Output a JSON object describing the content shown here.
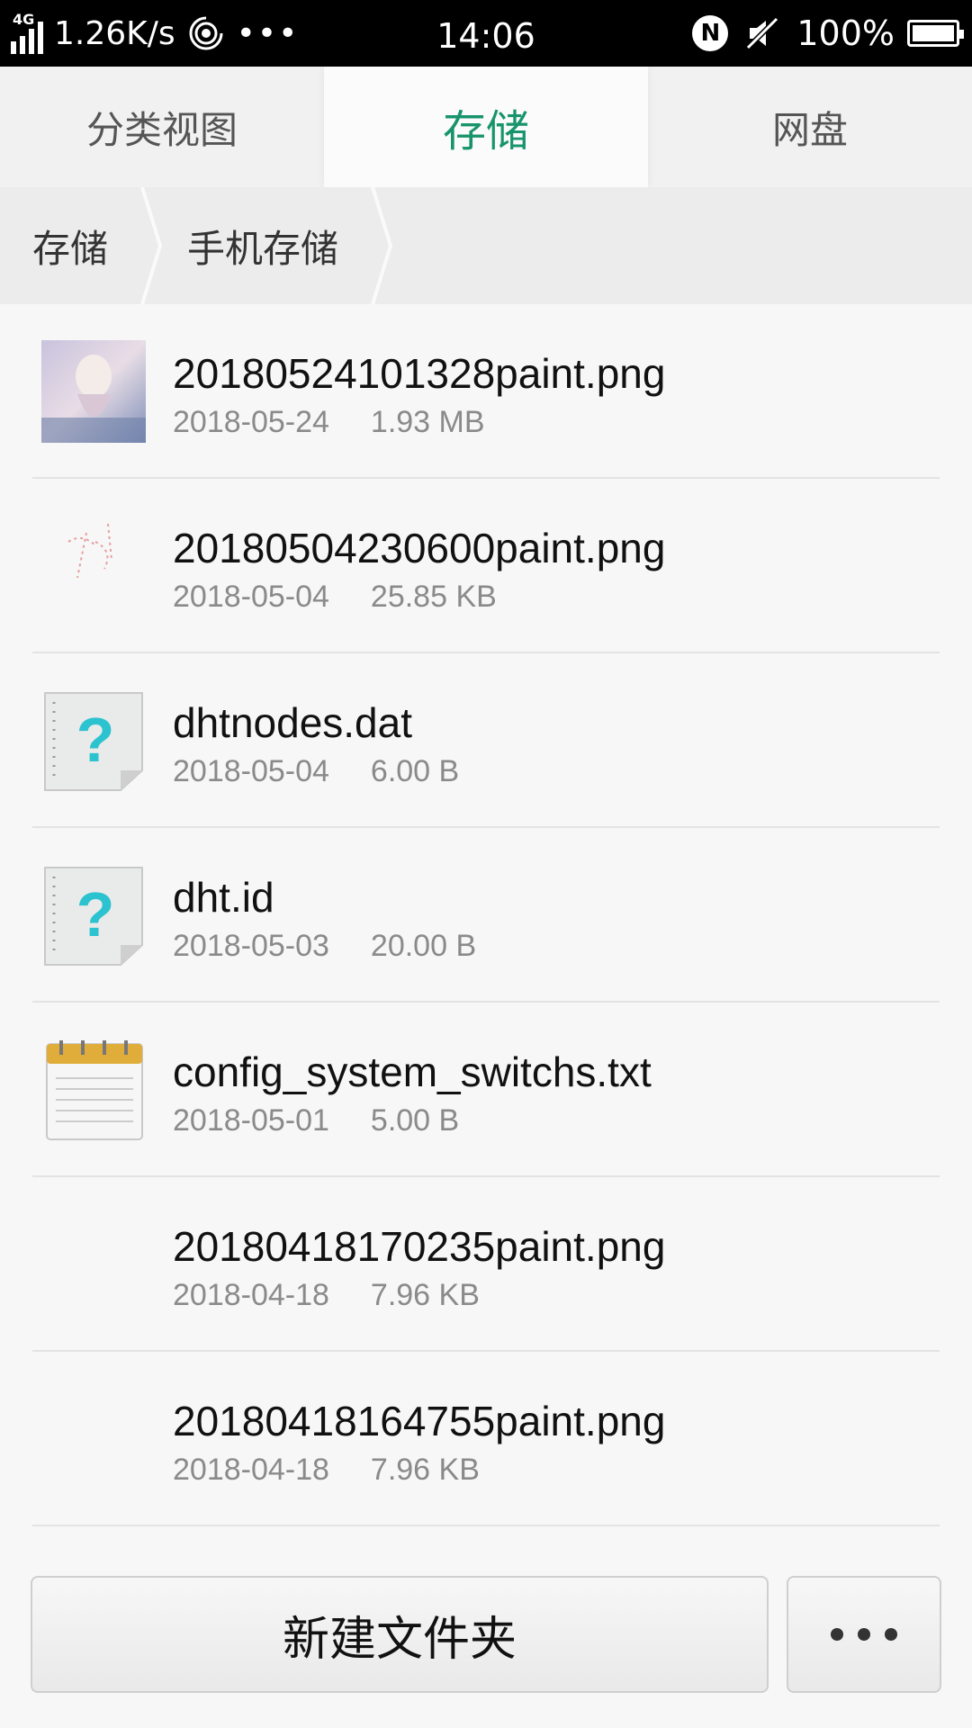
{
  "status_bar": {
    "network_type": "4G",
    "speed": "1.26K/s",
    "more": "•••",
    "time": "14:06",
    "nfc": "N",
    "battery": "100%"
  },
  "tabs": [
    {
      "label": "分类视图"
    },
    {
      "label": "存储"
    },
    {
      "label": "网盘"
    }
  ],
  "breadcrumb": [
    {
      "label": "存储"
    },
    {
      "label": "手机存储"
    }
  ],
  "files": [
    {
      "name": "20180524101328paint.png",
      "date": "2018-05-24",
      "size": "1.93 MB",
      "icon": "image-thumbnail"
    },
    {
      "name": "20180504230600paint.png",
      "date": "2018-05-04",
      "size": "25.85 KB",
      "icon": "sketch-thumbnail"
    },
    {
      "name": "dhtnodes.dat",
      "date": "2018-05-04",
      "size": "6.00 B",
      "icon": "unknown-file-icon"
    },
    {
      "name": "dht.id",
      "date": "2018-05-03",
      "size": "20.00 B",
      "icon": "unknown-file-icon"
    },
    {
      "name": "config_system_switchs.txt",
      "date": "2018-05-01",
      "size": "5.00 B",
      "icon": "notepad-icon"
    },
    {
      "name": "20180418170235paint.png",
      "date": "2018-04-18",
      "size": "7.96 KB",
      "icon": "blank-thumbnail"
    },
    {
      "name": "20180418164755paint.png",
      "date": "2018-04-18",
      "size": "7.96 KB",
      "icon": "blank-thumbnail"
    }
  ],
  "bottom": {
    "new_folder": "新建文件夹"
  },
  "colors": {
    "active_tab": "#18946c",
    "question_mark": "#2bc3cf"
  }
}
